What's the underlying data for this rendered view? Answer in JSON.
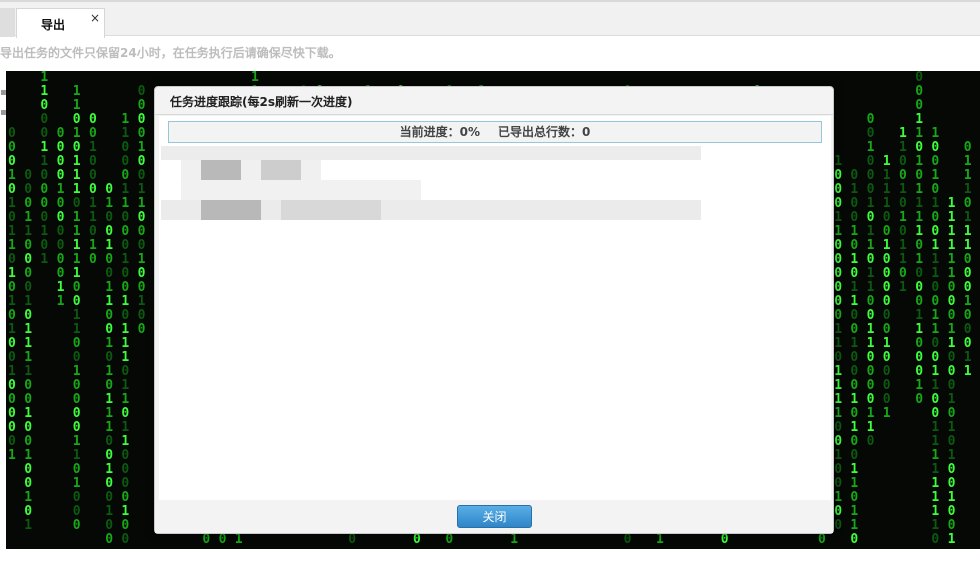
{
  "tabs": [
    {
      "label": "导出",
      "close_glyph": "×"
    }
  ],
  "notice_text": "导出任务的文件只保留24小时，在任务执行后请确保尽快下载。",
  "modal": {
    "title": "任务进度跟踪(每2s刷新一次进度)",
    "progress_label": "当前进度：0%",
    "exported_rows_label": "已导出总行数：0",
    "close_button": "关闭"
  },
  "icons": {
    "tab_close": "close-icon"
  },
  "colors": {
    "button_blue": "#2f86c7",
    "progress_border": "#97c6d9",
    "matrix_green": "#3cff3c",
    "matrix_background": "#050805"
  }
}
